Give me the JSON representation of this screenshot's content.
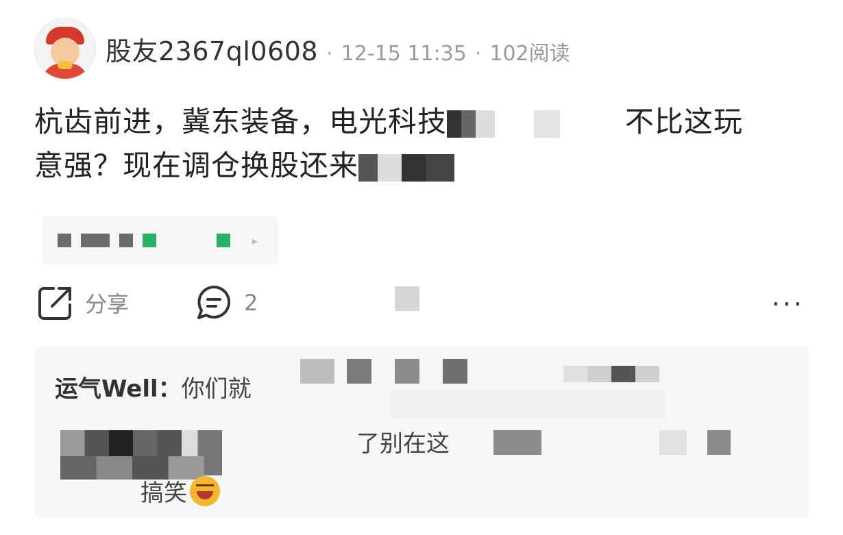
{
  "post": {
    "username": "股友2367ql0608",
    "time": "12-15 11:35",
    "reads": "102阅读",
    "separator": "·",
    "text_line1_part1": "杭齿前进，冀东装备，电光科技",
    "text_line1_part2": "不比这玩",
    "text_line2_part1": "意强？现在调仓换股还来"
  },
  "actions": {
    "share_label": "分享",
    "comment_count": "2",
    "more": "···"
  },
  "comments": {
    "name": "运气Well",
    "colon": "：",
    "text_start": "你们就",
    "line2_text": "了别在这",
    "line3_text": "搞笑"
  }
}
